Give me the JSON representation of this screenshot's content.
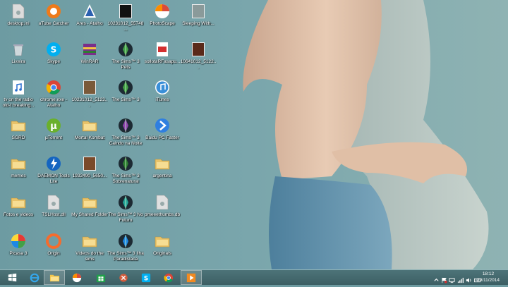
{
  "desktop": {
    "icons": [
      {
        "label": "desktop.ini",
        "icon": "ini-file-icon",
        "color": "#dcdcdc"
      },
      {
        "label": "aTube Catcher",
        "icon": "atube-catcher-icon",
        "color": "#ef7a1a"
      },
      {
        "label": "Ares - Atalho",
        "icon": "ares-icon",
        "color": "#2a5fb0"
      },
      {
        "label": "10231012_55748...",
        "icon": "image-file-icon",
        "color": "#111111"
      },
      {
        "label": "PhotoScape",
        "icon": "photoscape-icon",
        "color": "#d94a3a"
      },
      {
        "label": "Sleeping With...",
        "icon": "image-file-icon",
        "color": "#8a9a9a"
      },
      {
        "label": "Lixeira",
        "icon": "recycle-bin-icon",
        "color": "#cfd8dc"
      },
      {
        "label": "Skype",
        "icon": "skype-icon",
        "color": "#00aff0"
      },
      {
        "label": "WinRAR",
        "icon": "winrar-icon",
        "color": "#7a2f8a"
      },
      {
        "label": "The Sims™ 3 Pets",
        "icon": "sims-icon",
        "color": "#43a047"
      },
      {
        "label": "sollotaRFasapu...",
        "icon": "pdf-file-icon",
        "color": "#d32f2f"
      },
      {
        "label": "10641012_5122...",
        "icon": "image-file-icon",
        "color": "#5a2a1a"
      },
      {
        "label": "tv on the radio old-t breaking...",
        "icon": "audio-file-icon",
        "color": "#ffffff"
      },
      {
        "label": "chrome.exe - Atalho",
        "icon": "chrome-icon",
        "color": "#db4437"
      },
      {
        "label": "10231012_5123...",
        "icon": "image-file-icon",
        "color": "#7a5a3a"
      },
      {
        "label": "The Sims™ 3",
        "icon": "sims-icon",
        "color": "#43a047"
      },
      {
        "label": "iTunes",
        "icon": "itunes-icon",
        "color": "#3a8fd8"
      },
      {
        "label": "SGRD",
        "icon": "folder-icon",
        "color": "#e8c36a"
      },
      {
        "label": "µTorrent",
        "icon": "utorrent-icon",
        "color": "#6ab02c"
      },
      {
        "label": "Mortal Kombat",
        "icon": "folder-icon",
        "color": "#e8c36a"
      },
      {
        "label": "The Sims™ 3 Caindo na Noite",
        "icon": "sims-icon",
        "color": "#8e44ad"
      },
      {
        "label": "Baidu PC Faster",
        "icon": "baidu-icon",
        "color": "#2f7fe0"
      },
      {
        "label": "memes",
        "icon": "folder-icon",
        "color": "#e8c36a"
      },
      {
        "label": "DAEMON Tools Lite",
        "icon": "daemon-tools-icon",
        "color": "#1565c0"
      },
      {
        "label": "1932490_5650...",
        "icon": "image-file-icon",
        "color": "#7a4a2a"
      },
      {
        "label": "The Sims™ 3 Sobrenatural",
        "icon": "sims-icon",
        "color": "#2e7d32"
      },
      {
        "label": "argentina",
        "icon": "folder-icon",
        "color": "#e8c36a"
      },
      {
        "label": "Fotos e videos",
        "icon": "folder-icon",
        "color": "#e8c36a"
      },
      {
        "label": "TSLHost.dll",
        "icon": "dll-file-icon",
        "color": "#e0e0e0"
      },
      {
        "label": "My Shared Folder",
        "icon": "folder-icon",
        "color": "#e8c36a"
      },
      {
        "label": "The Sims™ 3 No Futuro",
        "icon": "sims-icon",
        "color": "#26a69a"
      },
      {
        "label": "pmeeethumbs.db",
        "icon": "db-file-icon",
        "color": "#e0e0e0"
      },
      {
        "label": "Picasa 3",
        "icon": "picasa-icon",
        "color": "#e53935"
      },
      {
        "label": "Origin",
        "icon": "origin-icon",
        "color": "#f56c2d"
      },
      {
        "label": "Videos do the sims",
        "icon": "folder-icon",
        "color": "#e8c36a"
      },
      {
        "label": "The Sims™ 3 Ilha Paradisíaca",
        "icon": "sims-icon",
        "color": "#1e88e5"
      },
      {
        "label": "Originals",
        "icon": "folder-icon",
        "color": "#e8c36a"
      }
    ]
  },
  "taskbar": {
    "apps": [
      {
        "icon": "windows-start-icon",
        "active": false
      },
      {
        "icon": "internet-explorer-icon",
        "active": false
      },
      {
        "icon": "file-explorer-icon",
        "active": true
      },
      {
        "icon": "photoscape-icon",
        "active": false
      },
      {
        "icon": "windows-store-icon",
        "active": false
      },
      {
        "icon": "tsl-icon",
        "active": false
      },
      {
        "icon": "skype-icon",
        "active": false
      },
      {
        "icon": "chrome-icon",
        "active": false
      },
      {
        "icon": "media-player-icon",
        "active": true
      }
    ],
    "tray": {
      "icons": [
        "show-hidden-icons-icon",
        "flag-icon",
        "network-icon",
        "signal-icon",
        "volume-icon",
        "keyboard-icon"
      ],
      "time": "18:12",
      "date": "29/11/2014"
    }
  }
}
